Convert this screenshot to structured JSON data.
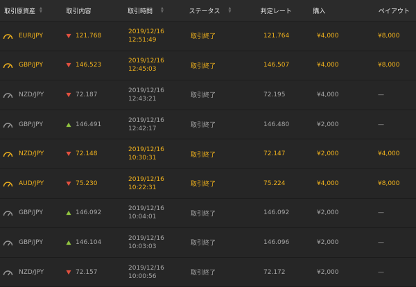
{
  "header": {
    "asset": "取引原資産",
    "price": "取引内容",
    "time": "取引時間",
    "status": "ステータス",
    "rate": "判定レート",
    "buy": "購入",
    "payout": "ペイアウト"
  },
  "colors": {
    "win": "#f2b31d",
    "lose": "#a8a8a8",
    "down": "#e2503f",
    "up": "#8fc23f"
  },
  "rows": [
    {
      "result": "win",
      "asset": "EUR/JPY",
      "dir": "down",
      "price": "121.768",
      "date": "2019/12/16",
      "clock": "12:51:49",
      "status": "取引終了",
      "rate": "121.764",
      "buy": "¥4,000",
      "payout": "¥8,000"
    },
    {
      "result": "win",
      "asset": "GBP/JPY",
      "dir": "down",
      "price": "146.523",
      "date": "2019/12/16",
      "clock": "12:45:03",
      "status": "取引終了",
      "rate": "146.507",
      "buy": "¥4,000",
      "payout": "¥8,000"
    },
    {
      "result": "lose",
      "asset": "NZD/JPY",
      "dir": "down",
      "price": "72.187",
      "date": "2019/12/16",
      "clock": "12:43:21",
      "status": "取引終了",
      "rate": "72.195",
      "buy": "¥4,000",
      "payout": "—"
    },
    {
      "result": "lose",
      "asset": "GBP/JPY",
      "dir": "up",
      "price": "146.491",
      "date": "2019/12/16",
      "clock": "12:42:17",
      "status": "取引終了",
      "rate": "146.480",
      "buy": "¥2,000",
      "payout": "—"
    },
    {
      "result": "win",
      "asset": "NZD/JPY",
      "dir": "down",
      "price": "72.148",
      "date": "2019/12/16",
      "clock": "10:30:31",
      "status": "取引終了",
      "rate": "72.147",
      "buy": "¥2,000",
      "payout": "¥4,000"
    },
    {
      "result": "win",
      "asset": "AUD/JPY",
      "dir": "down",
      "price": "75.230",
      "date": "2019/12/16",
      "clock": "10:22:31",
      "status": "取引終了",
      "rate": "75.224",
      "buy": "¥4,000",
      "payout": "¥8,000"
    },
    {
      "result": "lose",
      "asset": "GBP/JPY",
      "dir": "up",
      "price": "146.092",
      "date": "2019/12/16",
      "clock": "10:04:01",
      "status": "取引終了",
      "rate": "146.092",
      "buy": "¥2,000",
      "payout": "—"
    },
    {
      "result": "lose",
      "asset": "GBP/JPY",
      "dir": "up",
      "price": "146.104",
      "date": "2019/12/16",
      "clock": "10:03:03",
      "status": "取引終了",
      "rate": "146.096",
      "buy": "¥2,000",
      "payout": "—"
    },
    {
      "result": "lose",
      "asset": "NZD/JPY",
      "dir": "down",
      "price": "72.157",
      "date": "2019/12/16",
      "clock": "10:00:56",
      "status": "取引終了",
      "rate": "72.172",
      "buy": "¥2,000",
      "payout": "—"
    }
  ]
}
